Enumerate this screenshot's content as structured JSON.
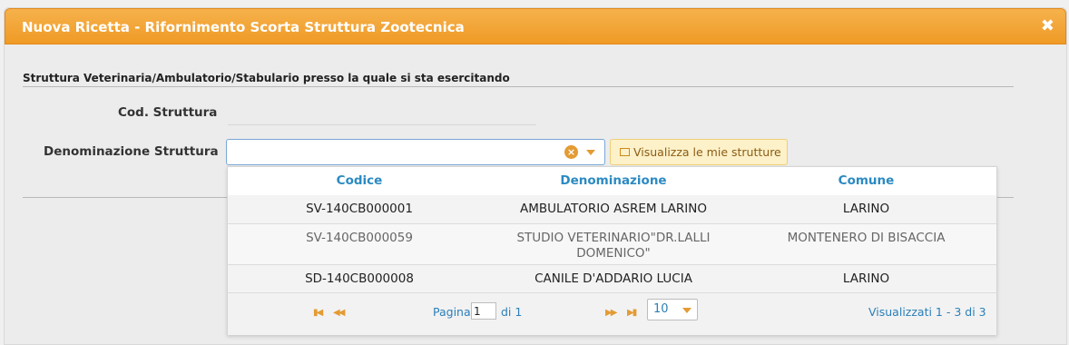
{
  "dialog": {
    "title": "Nuova Ricetta - Rifornimento Scorta Struttura Zootecnica",
    "close_icon": "close-icon"
  },
  "form": {
    "section_title": "Struttura Veterinaria/Ambulatorio/Stabulario presso la quale si sta esercitando",
    "cod_label": "Cod. Struttura",
    "cod_value": "",
    "den_label": "Denominazione Struttura",
    "den_value": "",
    "view_button": "Visualizza le mie strutture"
  },
  "grid": {
    "columns": [
      "Codice",
      "Denominazione",
      "Comune"
    ],
    "rows": [
      {
        "codice": "SV-140CB000001",
        "denominazione": "AMBULATORIO ASREM LARINO",
        "comune": "LARINO"
      },
      {
        "codice": "SV-140CB000059",
        "denominazione_l1": "STUDIO VETERINARIO\"DR.LALLI",
        "denominazione_l2": "DOMENICO\"",
        "comune": "MONTENERO DI BISACCIA"
      },
      {
        "codice": "SD-140CB000008",
        "denominazione": "CANILE D'ADDARIO LUCIA",
        "comune": "LARINO"
      }
    ]
  },
  "pager": {
    "page_label": "Pagina",
    "page_value": "1",
    "of_label": "di 1",
    "page_size": "10",
    "status": "Visualizzati 1 - 3 di 3"
  },
  "colors": {
    "accent": "#ef9a25",
    "link": "#2b8ac2"
  }
}
